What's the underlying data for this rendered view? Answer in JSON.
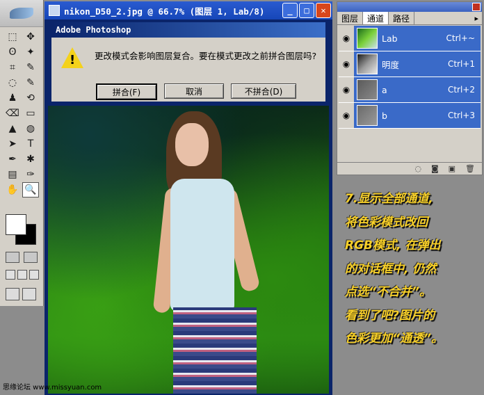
{
  "document": {
    "title": "nikon_D50_2.jpg @ 66.7% (图层 1, Lab/8)",
    "buttons": {
      "minimize": "_",
      "maximize": "□",
      "close": "✕"
    }
  },
  "dialog": {
    "title": "Adobe Photoshop",
    "message": "更改模式会影响图层复合。要在模式更改之前拼合图层吗?",
    "icon": "warning-icon",
    "buttons": [
      "拼合(F)",
      "取消",
      "不拼合(D)"
    ]
  },
  "channels_panel": {
    "tabs": [
      "图层",
      "通道",
      "路径"
    ],
    "active_tab": "通道",
    "menu_arrow": "▸",
    "channels": [
      {
        "name": "Lab",
        "shortcut": "Ctrl+~"
      },
      {
        "name": "明度",
        "shortcut": "Ctrl+1"
      },
      {
        "name": "a",
        "shortcut": "Ctrl+2"
      },
      {
        "name": "b",
        "shortcut": "Ctrl+3"
      }
    ],
    "eye_icon": "◉",
    "footer_icons": [
      "load-selection-icon",
      "save-selection-icon",
      "new-channel-icon",
      "delete-channel-icon"
    ],
    "footer_glyphs": [
      "◌",
      "◙",
      "▣",
      "🗑"
    ]
  },
  "toolbox": {
    "tool_glyphs": [
      "⬚",
      "✥",
      "ʘ",
      "✦",
      "⌗",
      "✎",
      "◌",
      "✎",
      "♟",
      "⟲",
      "⌫",
      "▭",
      "▲",
      "◍",
      "➤",
      "T",
      "✒",
      "✱",
      "▤",
      "✑",
      "✋",
      "🔍"
    ],
    "tools": [
      "marquee-tool",
      "move-tool",
      "lasso-tool",
      "magic-wand-tool",
      "crop-tool",
      "slice-tool",
      "healing-brush-tool",
      "brush-tool",
      "clone-stamp-tool",
      "history-brush-tool",
      "eraser-tool",
      "gradient-tool",
      "blur-tool",
      "dodge-tool",
      "path-selection-tool",
      "type-tool",
      "pen-tool",
      "custom-shape-tool",
      "notes-tool",
      "eyedropper-tool",
      "hand-tool",
      "zoom-tool"
    ],
    "selected_tool": "zoom-tool",
    "foreground_color": "#ffffff",
    "background_color": "#000000"
  },
  "caption": {
    "lines": [
      "7.显示全部通道,",
      "将色彩模式改回",
      "RGB模式, 在弹出",
      "的对话框中, 仍然",
      "点选“不合并”。",
      "看到了吧?图片的",
      "色彩更加“通透”。"
    ],
    "color": "#f8d028"
  },
  "watermark": "思缘论坛 www.missyuan.com"
}
